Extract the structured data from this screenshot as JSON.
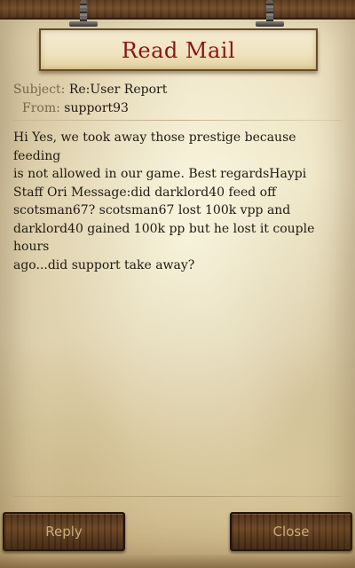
{
  "header": {
    "title": "Read Mail"
  },
  "mail": {
    "subject_label": "Subject:",
    "subject_value": "Re:User Report",
    "from_label": "From:",
    "from_value": "support93",
    "body": "Hi Yes, we took away those prestige because feeding\nis not allowed in our game. Best regardsHaypi\nStaff  Ori Message:did darklord40 feed off\nscotsman67? scotsman67 lost 100k vpp and\ndarklord40 gained 100k pp but he lost it couple hours\nago...did support take away?"
  },
  "actions": {
    "reply_label": "Reply",
    "close_label": "Close"
  },
  "colors": {
    "title": "#8a1414",
    "button_text": "#c9b27a",
    "label_text": "#7a6a4e"
  }
}
